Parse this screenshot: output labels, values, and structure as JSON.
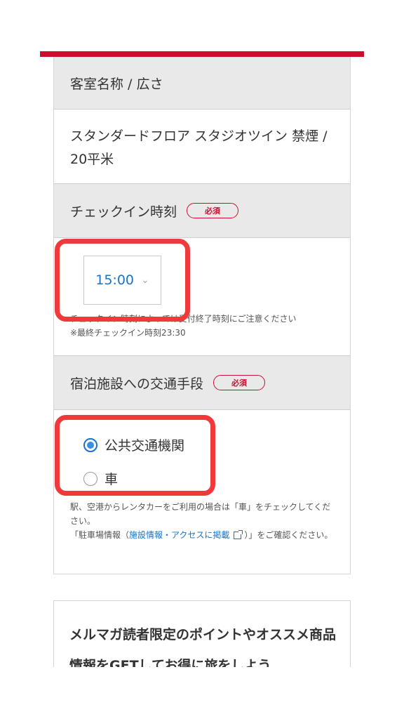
{
  "room": {
    "header": "客室名称 / 広さ",
    "value": "スタンダードフロア スタジオツイン 禁煙 / 20平米"
  },
  "checkin": {
    "header": "チェックイン時刻",
    "required_badge": "必須",
    "selected_time": "15:00",
    "note_line1": "チェックイン時刻によっては受付終了時刻にご注意ください",
    "note_line2": "※最終チェックイン時刻23:30"
  },
  "transport": {
    "header": "宿泊施設への交通手段",
    "required_badge": "必須",
    "options": [
      {
        "label": "公共交通機関",
        "checked": true
      },
      {
        "label": "車",
        "checked": false
      }
    ],
    "help_text1": "駅、空港からレンタカーをご利用の場合は「車」をチェックしてください。",
    "help_prefix": "「駐車場情報（",
    "help_link": "施設情報・アクセスに掲載",
    "help_suffix": "）」をご確認ください。"
  },
  "promo": {
    "text": "メルマガ読者限定のポイントやオススメ商品情報をGETしてお得に旅をしよう"
  },
  "colors": {
    "accent_red": "#c8102e",
    "link_blue": "#1a73c8",
    "highlight": "#ee3a3a",
    "header_bg": "#e9e9ea"
  }
}
